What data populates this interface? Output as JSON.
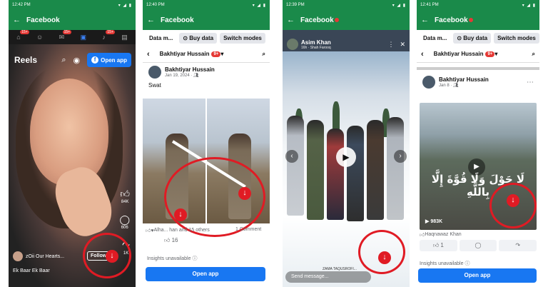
{
  "colors": {
    "fb_green": "#1a8a4a",
    "fb_blue": "#1877f2",
    "annotation_red": "#e01b24"
  },
  "panel1": {
    "status_time": "12:42 PM",
    "app_title": "Facebook",
    "nav_badges": [
      "15+",
      "15+",
      "15+"
    ],
    "reels_title": "Reels",
    "open_app": "Open app",
    "likes": "84K",
    "comments": "606",
    "shares": "1K",
    "author": "zOii Our Hearts...",
    "follow": "Follow",
    "caption": "Ek Baar Ek Baar"
  },
  "panel2": {
    "status_time": "12:40 PM",
    "app_title": "Facebook",
    "tabs": [
      "Data m...",
      "Buy data",
      "Switch modes"
    ],
    "profile_name": "Bakhtiyar Hussain",
    "profile_badge": "9+",
    "post_author": "Bakhtiyar Hussain",
    "post_date": "Jan 19, 2024 · ",
    "post_text": "Swat",
    "reactions": "Alha... han and 15 others",
    "comments_count": "1 Comment",
    "like_count": "16",
    "insights": "Insights unavailable",
    "open_app": "Open app"
  },
  "panel3": {
    "status_time": "12:39 PM",
    "app_title": "Facebook",
    "story_author": "Asim Khan",
    "story_sub": "16h · Shah Farooq",
    "watermark": "ZAMA TAQUSROFI... ",
    "send_message": "Send message..."
  },
  "panel4": {
    "status_time": "12:41 PM",
    "app_title": "Facebook",
    "tabs": [
      "Data m...",
      "Buy data",
      "Switch modes"
    ],
    "profile_name": "Bakhtiyar Hussain",
    "profile_badge": "9+",
    "post_author": "Bakhtiyar Hussain",
    "post_date": "Jan 8 · ",
    "arabic_text": "لَا حَوْلَ وَلَا قُوَّةَ إِلَّا بِاللَّهِ",
    "views": "983K",
    "reactions": "Haqnawaz Khan",
    "like_count": "1",
    "insights": "Insights unavailable",
    "open_app": "Open app"
  }
}
